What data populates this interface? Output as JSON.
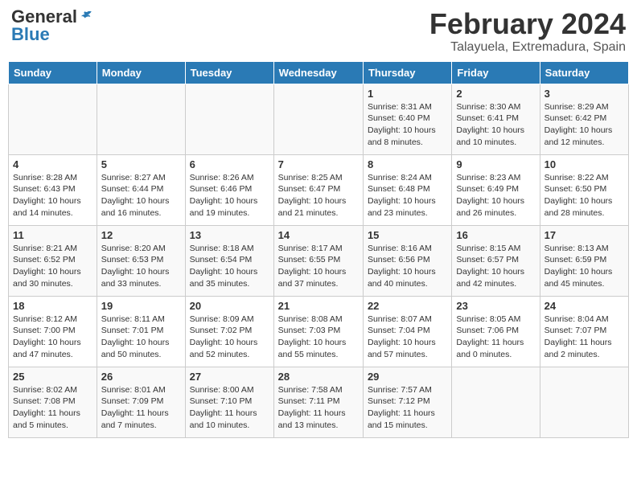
{
  "logo": {
    "general": "General",
    "blue": "Blue"
  },
  "title": "February 2024",
  "subtitle": "Talayuela, Extremadura, Spain",
  "headers": [
    "Sunday",
    "Monday",
    "Tuesday",
    "Wednesday",
    "Thursday",
    "Friday",
    "Saturday"
  ],
  "weeks": [
    [
      {
        "day": "",
        "info": ""
      },
      {
        "day": "",
        "info": ""
      },
      {
        "day": "",
        "info": ""
      },
      {
        "day": "",
        "info": ""
      },
      {
        "day": "1",
        "info": "Sunrise: 8:31 AM\nSunset: 6:40 PM\nDaylight: 10 hours and 8 minutes."
      },
      {
        "day": "2",
        "info": "Sunrise: 8:30 AM\nSunset: 6:41 PM\nDaylight: 10 hours and 10 minutes."
      },
      {
        "day": "3",
        "info": "Sunrise: 8:29 AM\nSunset: 6:42 PM\nDaylight: 10 hours and 12 minutes."
      }
    ],
    [
      {
        "day": "4",
        "info": "Sunrise: 8:28 AM\nSunset: 6:43 PM\nDaylight: 10 hours and 14 minutes."
      },
      {
        "day": "5",
        "info": "Sunrise: 8:27 AM\nSunset: 6:44 PM\nDaylight: 10 hours and 16 minutes."
      },
      {
        "day": "6",
        "info": "Sunrise: 8:26 AM\nSunset: 6:46 PM\nDaylight: 10 hours and 19 minutes."
      },
      {
        "day": "7",
        "info": "Sunrise: 8:25 AM\nSunset: 6:47 PM\nDaylight: 10 hours and 21 minutes."
      },
      {
        "day": "8",
        "info": "Sunrise: 8:24 AM\nSunset: 6:48 PM\nDaylight: 10 hours and 23 minutes."
      },
      {
        "day": "9",
        "info": "Sunrise: 8:23 AM\nSunset: 6:49 PM\nDaylight: 10 hours and 26 minutes."
      },
      {
        "day": "10",
        "info": "Sunrise: 8:22 AM\nSunset: 6:50 PM\nDaylight: 10 hours and 28 minutes."
      }
    ],
    [
      {
        "day": "11",
        "info": "Sunrise: 8:21 AM\nSunset: 6:52 PM\nDaylight: 10 hours and 30 minutes."
      },
      {
        "day": "12",
        "info": "Sunrise: 8:20 AM\nSunset: 6:53 PM\nDaylight: 10 hours and 33 minutes."
      },
      {
        "day": "13",
        "info": "Sunrise: 8:18 AM\nSunset: 6:54 PM\nDaylight: 10 hours and 35 minutes."
      },
      {
        "day": "14",
        "info": "Sunrise: 8:17 AM\nSunset: 6:55 PM\nDaylight: 10 hours and 37 minutes."
      },
      {
        "day": "15",
        "info": "Sunrise: 8:16 AM\nSunset: 6:56 PM\nDaylight: 10 hours and 40 minutes."
      },
      {
        "day": "16",
        "info": "Sunrise: 8:15 AM\nSunset: 6:57 PM\nDaylight: 10 hours and 42 minutes."
      },
      {
        "day": "17",
        "info": "Sunrise: 8:13 AM\nSunset: 6:59 PM\nDaylight: 10 hours and 45 minutes."
      }
    ],
    [
      {
        "day": "18",
        "info": "Sunrise: 8:12 AM\nSunset: 7:00 PM\nDaylight: 10 hours and 47 minutes."
      },
      {
        "day": "19",
        "info": "Sunrise: 8:11 AM\nSunset: 7:01 PM\nDaylight: 10 hours and 50 minutes."
      },
      {
        "day": "20",
        "info": "Sunrise: 8:09 AM\nSunset: 7:02 PM\nDaylight: 10 hours and 52 minutes."
      },
      {
        "day": "21",
        "info": "Sunrise: 8:08 AM\nSunset: 7:03 PM\nDaylight: 10 hours and 55 minutes."
      },
      {
        "day": "22",
        "info": "Sunrise: 8:07 AM\nSunset: 7:04 PM\nDaylight: 10 hours and 57 minutes."
      },
      {
        "day": "23",
        "info": "Sunrise: 8:05 AM\nSunset: 7:06 PM\nDaylight: 11 hours and 0 minutes."
      },
      {
        "day": "24",
        "info": "Sunrise: 8:04 AM\nSunset: 7:07 PM\nDaylight: 11 hours and 2 minutes."
      }
    ],
    [
      {
        "day": "25",
        "info": "Sunrise: 8:02 AM\nSunset: 7:08 PM\nDaylight: 11 hours and 5 minutes."
      },
      {
        "day": "26",
        "info": "Sunrise: 8:01 AM\nSunset: 7:09 PM\nDaylight: 11 hours and 7 minutes."
      },
      {
        "day": "27",
        "info": "Sunrise: 8:00 AM\nSunset: 7:10 PM\nDaylight: 11 hours and 10 minutes."
      },
      {
        "day": "28",
        "info": "Sunrise: 7:58 AM\nSunset: 7:11 PM\nDaylight: 11 hours and 13 minutes."
      },
      {
        "day": "29",
        "info": "Sunrise: 7:57 AM\nSunset: 7:12 PM\nDaylight: 11 hours and 15 minutes."
      },
      {
        "day": "",
        "info": ""
      },
      {
        "day": "",
        "info": ""
      }
    ]
  ]
}
